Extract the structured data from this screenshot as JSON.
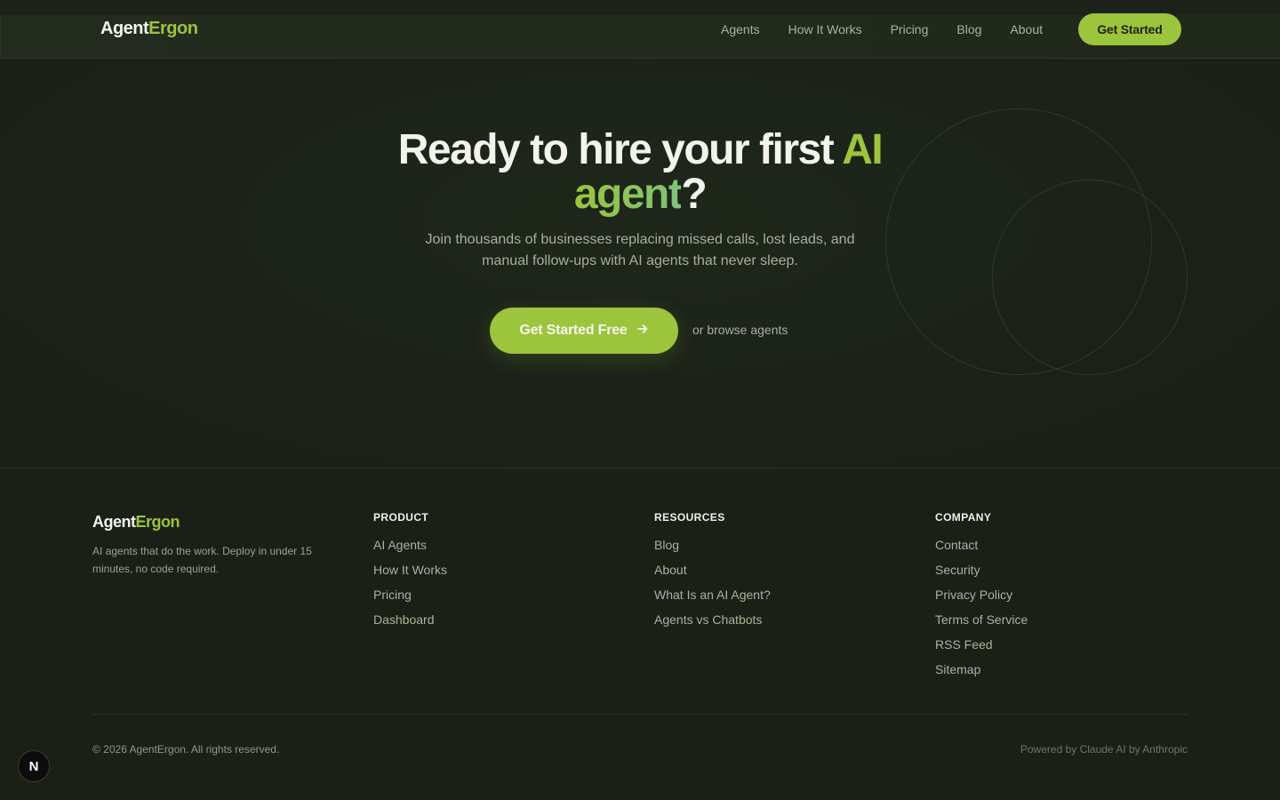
{
  "brand": {
    "name_part1": "Agent",
    "name_part2": "Ergon"
  },
  "nav": {
    "links": [
      "Agents",
      "How It Works",
      "Pricing",
      "Blog",
      "About"
    ],
    "cta": "Get Started"
  },
  "hero": {
    "headline_main": "Ready to hire your first ",
    "headline_accent1": "AI",
    "headline_accent2": "agent",
    "headline_end": "?",
    "subtitle": "Join thousands of businesses replacing missed calls, lost leads, and manual follow-ups with AI agents that never sleep.",
    "cta": "Get Started Free",
    "cta_icon": "arrow-right-icon",
    "secondary": "or browse agents"
  },
  "footer": {
    "tagline": "AI agents that do the work. Deploy in under 15 minutes, no code required.",
    "columns": [
      {
        "title": "PRODUCT",
        "links": [
          "AI Agents",
          "How It Works",
          "Pricing",
          "Dashboard"
        ]
      },
      {
        "title": "RESOURCES",
        "links": [
          "Blog",
          "About",
          "What Is an AI Agent?",
          "Agents vs Chatbots"
        ]
      },
      {
        "title": "COMPANY",
        "links": [
          "Contact",
          "Security",
          "Privacy Policy",
          "Terms of Service",
          "RSS Feed",
          "Sitemap"
        ]
      }
    ],
    "copyright": "© 2026 AgentErgon. All rights reserved.",
    "powered": "Powered by Claude AI by Anthropic"
  },
  "badge": {
    "letter": "N",
    "icon": "nextjs-icon"
  },
  "colors": {
    "accent": "#9cc43c",
    "background": "#1a2016",
    "text": "#f2f4ec"
  }
}
